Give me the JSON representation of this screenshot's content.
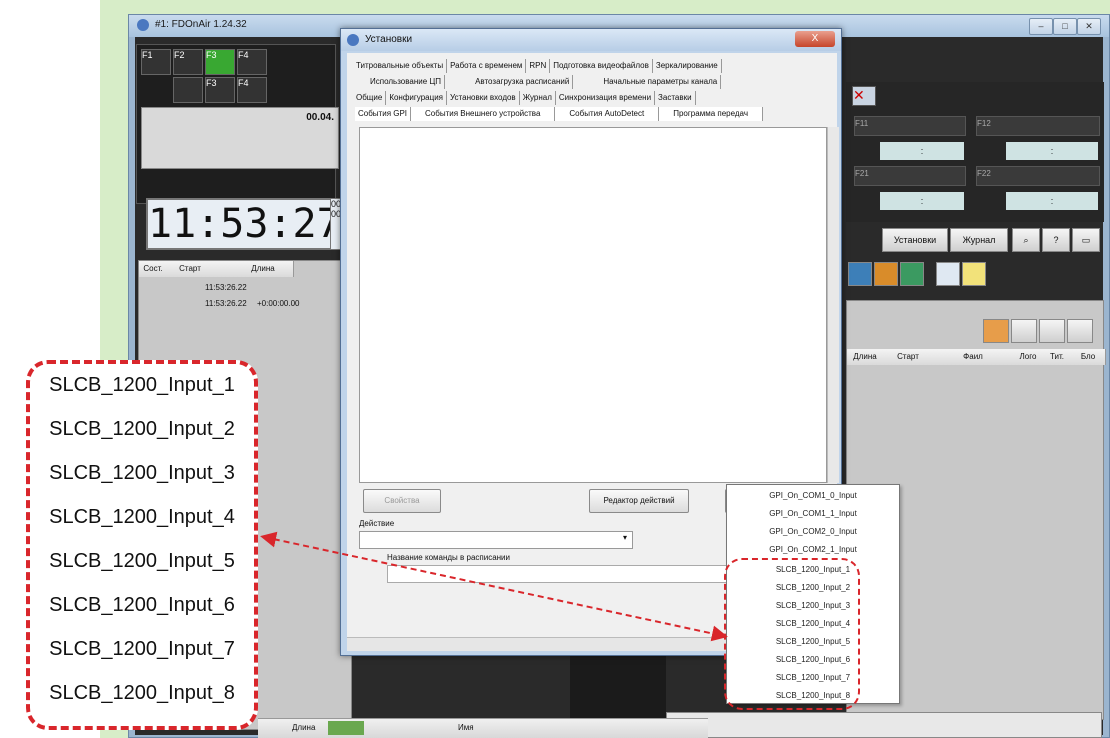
{
  "main_window": {
    "title": "#1: FDOnAir 1.24.32",
    "fkeys": [
      "F1",
      "F2",
      "F3",
      "F4"
    ],
    "fkeys_row2": [
      "",
      "F3",
      "F4"
    ],
    "timecode_small": "00.04.",
    "clock": "11:53:27",
    "clock_side": [
      "00",
      "00"
    ],
    "list_headers": [
      "Сост.",
      "Старт",
      "",
      "Длина"
    ],
    "list_rows": [
      {
        "time": "11:53:26.22",
        "dur": ""
      },
      {
        "time": "11:53:26.22",
        "dur": "+0:00:00.00"
      }
    ],
    "right_cells": [
      "F11",
      "F12",
      "F21",
      "F22"
    ],
    "right_bars": [
      ":",
      ":",
      ":",
      ":"
    ],
    "right_buttons": [
      "Установки",
      "Журнал"
    ],
    "grid_headers": [
      "Длина",
      "Старт",
      "Фаил",
      "Лого",
      "Тит.",
      "Бло"
    ],
    "bottom_headers": [
      "Длина",
      "Имя"
    ]
  },
  "dialog": {
    "title": "Установки",
    "close_label": "X",
    "tabs_row1": [
      "Титровальные объекты",
      "Работа с временем",
      "RPN",
      "Подготовка видеофайлов",
      "Зеркалирование"
    ],
    "tabs_row2": [
      "Использование ЦП",
      "Автозагрузка расписаний",
      "Начальные параметры канала"
    ],
    "tabs_row3": [
      "Общие",
      "Конфигурация",
      "Установки входов",
      "Журнал",
      "Синхронизация времени",
      "Заставки"
    ],
    "tabs_row4": [
      "События GPI",
      "События Внешнего устройства",
      "События AutoDetect",
      "Программа передач"
    ],
    "btn_properties": "Свойства",
    "btn_action_editor": "Редактор действий",
    "label_action": "Действие",
    "label_command": "Название команды в расписании"
  },
  "dropdown_items": [
    "GPI_On_COM1_0_Input",
    "GPI_On_COM1_1_Input",
    "GPI_On_COM2_0_Input",
    "GPI_On_COM2_1_Input",
    "SLCB_1200_Input_1",
    "SLCB_1200_Input_2",
    "SLCB_1200_Input_3",
    "SLCB_1200_Input_4",
    "SLCB_1200_Input_5",
    "SLCB_1200_Input_6",
    "SLCB_1200_Input_7",
    "SLCB_1200_Input_8"
  ],
  "callout_items": [
    "SLCB_1200_Input_1",
    "SLCB_1200_Input_2",
    "SLCB_1200_Input_3",
    "SLCB_1200_Input_4",
    "SLCB_1200_Input_5",
    "SLCB_1200_Input_6",
    "SLCB_1200_Input_7",
    "SLCB_1200_Input_8"
  ],
  "colors": {
    "highlight_red": "#d9262b",
    "background_green": "#d7edc8",
    "active_fkey": "#39a832"
  }
}
